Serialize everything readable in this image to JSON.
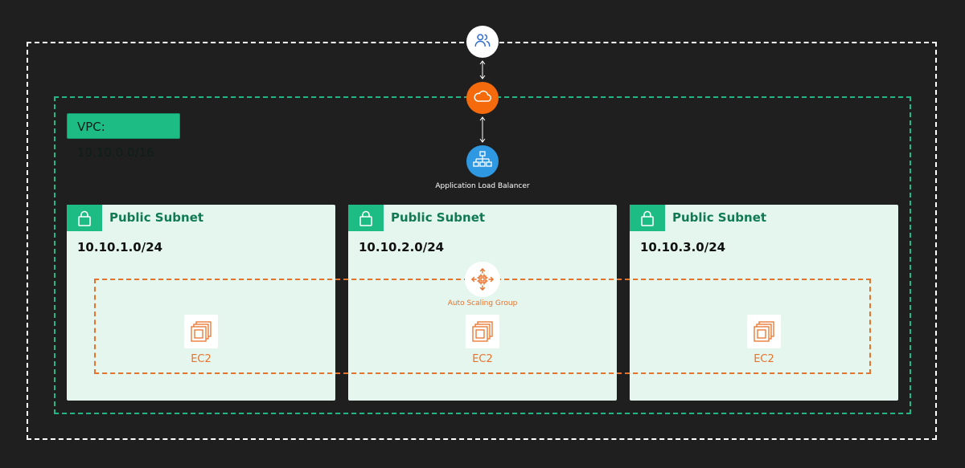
{
  "vpc": {
    "label": "VPC: 10.10.0.0/16"
  },
  "nodes": {
    "users_icon": "users-icon",
    "cloud_icon": "cloud-icon",
    "alb_icon": "network-hierarchy-icon",
    "alb_label": "Application Load Balancer"
  },
  "subnets": [
    {
      "title": "Public Subnet",
      "cidr": "10.10.1.0/24",
      "icon": "lock-icon"
    },
    {
      "title": "Public Subnet",
      "cidr": "10.10.2.0/24",
      "icon": "lock-icon"
    },
    {
      "title": "Public Subnet",
      "cidr": "10.10.3.0/24",
      "icon": "lock-icon"
    }
  ],
  "asg": {
    "label": "Auto Scaling Group",
    "icon": "auto-scaling-icon"
  },
  "instances": [
    {
      "label": "EC2",
      "icon": "ec2-instance-icon"
    },
    {
      "label": "EC2",
      "icon": "ec2-instance-icon"
    },
    {
      "label": "EC2",
      "icon": "ec2-instance-icon"
    }
  ],
  "colors": {
    "background": "#1f1f1f",
    "vpc_green": "#1ebc85",
    "subnet_fill": "#e5f6ef",
    "subnet_title": "#107a55",
    "orange": "#e8722a",
    "cloud_orange": "#f46a0c",
    "alb_blue": "#2f98e2",
    "users_blue": "#2f6bd1"
  }
}
